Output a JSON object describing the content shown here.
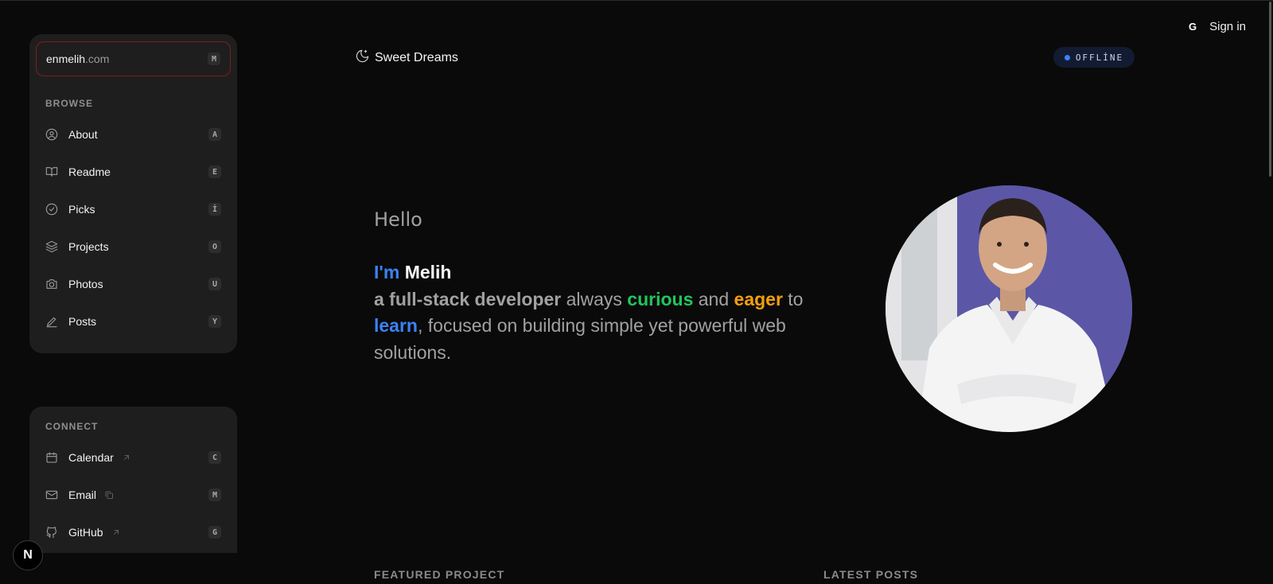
{
  "site": {
    "name": "enmelih",
    "tld": ".com",
    "shortcut": "M"
  },
  "browse": {
    "title": "BROWSE",
    "items": [
      {
        "label": "About",
        "key": "A",
        "icon": "user-circle-icon"
      },
      {
        "label": "Readme",
        "key": "E",
        "icon": "book-open-icon"
      },
      {
        "label": "Picks",
        "key": "İ",
        "icon": "check-circle-icon"
      },
      {
        "label": "Projects",
        "key": "O",
        "icon": "layers-icon"
      },
      {
        "label": "Photos",
        "key": "U",
        "icon": "camera-icon"
      },
      {
        "label": "Posts",
        "key": "Y",
        "icon": "pencil-icon"
      }
    ]
  },
  "connect": {
    "title": "CONNECT",
    "items": [
      {
        "label": "Calendar",
        "key": "C",
        "icon": "calendar-icon",
        "ext": "arrow-up-right-icon"
      },
      {
        "label": "Email",
        "key": "M",
        "icon": "mail-icon",
        "ext": "copy-icon"
      },
      {
        "label": "GitHub",
        "key": "G",
        "icon": "github-icon",
        "ext": "arrow-up-right-icon"
      }
    ]
  },
  "status": {
    "text": "Sweet Dreams",
    "icon": "moon-icon"
  },
  "badge": {
    "text": "OFFLİNE",
    "color": "#3b82f6"
  },
  "auth": {
    "google_icon": "G",
    "signin": "Sign in"
  },
  "hero": {
    "greeting": "Hello",
    "im": "I'm",
    "name": "Melih",
    "role": "a full-stack developer",
    "always": "always",
    "curious": "curious",
    "and": "and",
    "eager": "eager",
    "to": "to",
    "learn": "learn",
    "rest": ", focused on building simple yet powerful web solutions."
  },
  "sections": {
    "featured": "FEATURED PROJECT",
    "latest": "LATEST POSTS"
  },
  "dev_badge": "N",
  "colors": {
    "background": "#0a0a0a",
    "panel": "#1f1e1f",
    "blue": "#3b82f6",
    "green": "#22c55e",
    "amber": "#f59e0b"
  }
}
